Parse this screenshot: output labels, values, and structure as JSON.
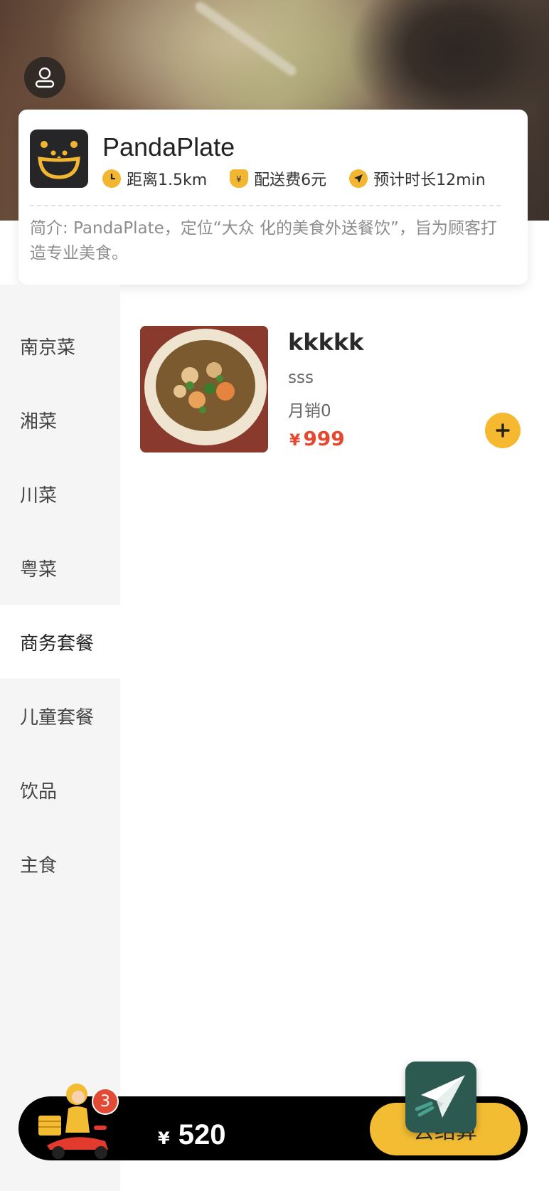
{
  "shop": {
    "name": "PandaPlate",
    "distance": "距离1.5km",
    "delivery_fee": "配送费6元",
    "eta": "预计时长12min",
    "intro": "简介: PandaPlate，定位“大众 化的美食外送餐饮”，旨为顾客打造专业美食。"
  },
  "categories": [
    {
      "label": "南京菜"
    },
    {
      "label": "湘菜"
    },
    {
      "label": "川菜"
    },
    {
      "label": "粤菜"
    },
    {
      "label": "商务套餐"
    },
    {
      "label": "儿童套餐"
    },
    {
      "label": "饮品"
    },
    {
      "label": "主食"
    }
  ],
  "active_category": "商务套餐",
  "dishes": [
    {
      "name": "kkkkk",
      "desc": "sss",
      "sales": "月销0",
      "currency": "¥",
      "price": "999"
    }
  ],
  "cart": {
    "badge_count": "3",
    "currency": "¥",
    "total": "520",
    "checkout_label": "去结算"
  },
  "colors": {
    "accent": "#f3bd33",
    "price": "#e4492f",
    "cart_bar": "#000000",
    "sidebar": "#f5f5f5"
  },
  "icons": {
    "avatar": "user-icon",
    "distance": "clock-icon",
    "fee": "money-bag-icon",
    "eta": "location-arrow-icon",
    "add": "plus-icon",
    "float": "paper-plane-icon"
  }
}
